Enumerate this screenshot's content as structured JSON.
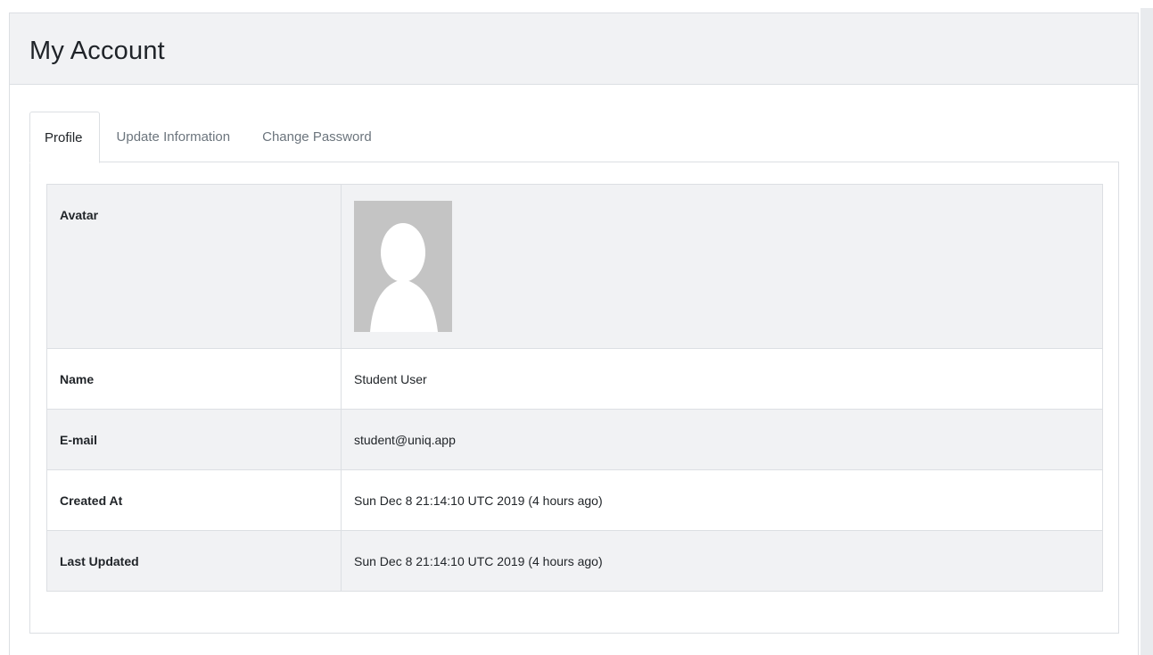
{
  "page": {
    "title": "My Account"
  },
  "tabs": [
    {
      "label": "Profile",
      "active": true
    },
    {
      "label": "Update Information",
      "active": false
    },
    {
      "label": "Change Password",
      "active": false
    }
  ],
  "profile": {
    "avatar_label": "Avatar",
    "avatar_icon": "default-user-silhouette",
    "rows": [
      {
        "label": "Name",
        "value": "Student User"
      },
      {
        "label": "E-mail",
        "value": "student@uniq.app"
      },
      {
        "label": "Created At",
        "value": "Sun Dec 8 21:14:10 UTC 2019 (4 hours ago)"
      },
      {
        "label": "Last Updated",
        "value": "Sun Dec 8 21:14:10 UTC 2019 (4 hours ago)"
      }
    ]
  },
  "colors": {
    "header_bg": "#f1f2f4",
    "border": "#dcdfe3",
    "avatar_bg": "#c4c4c4",
    "muted_text": "#6c757d"
  }
}
